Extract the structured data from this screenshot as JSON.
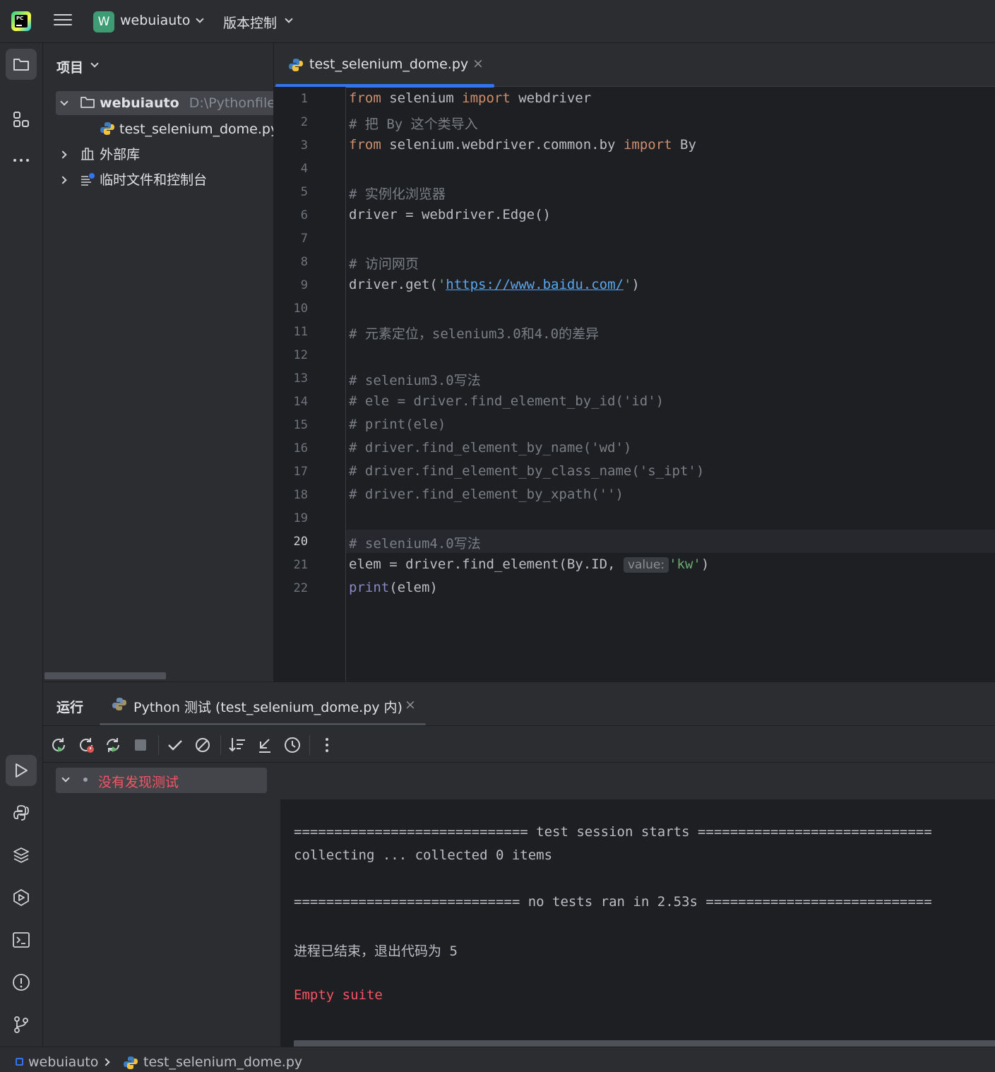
{
  "titlebar": {
    "project_initial": "W",
    "project_name": "webuiauto",
    "vcs_label": "版本控制"
  },
  "project_panel": {
    "title": "项目",
    "tree": [
      {
        "label": "webuiauto",
        "path": "D:\\Pythonfiles\\"
      },
      {
        "label": "test_selenium_dome.py"
      },
      {
        "label": "外部库"
      },
      {
        "label": "临时文件和控制台"
      }
    ]
  },
  "editor": {
    "tab_label": "test_selenium_dome.py",
    "tab_close": "×",
    "current_line": 20,
    "inlay_hint": "value:",
    "lines": {
      "l1": {
        "kw1": "from",
        "t1": " selenium ",
        "kw2": "import",
        "t2": " webdriver"
      },
      "l2": "# 把 By 这个类导入",
      "l3": {
        "kw1": "from",
        "t1": " selenium.webdriver.common.by ",
        "kw2": "import",
        "t2": " By"
      },
      "l5": "# 实例化浏览器",
      "l6": "driver = webdriver.Edge()",
      "l8": "# 访问网页",
      "l9": {
        "t1": "driver.get(",
        "q1": "'",
        "url": "https://www.baidu.com/",
        "q2": "'",
        "t2": ")"
      },
      "l11": "# 元素定位，selenium3.0和4.0的差异",
      "l13": "# selenium3.0写法",
      "l14": "# ele = driver.find_element_by_id('id')",
      "l15": "# print(ele)",
      "l16": "# driver.find_element_by_name('wd')",
      "l17": "# driver.find_element_by_class_name('s_ipt')",
      "l18": "# driver.find_element_by_xpath('')",
      "l20": "# selenium4.0写法",
      "l21": {
        "t1": "elem = driver.find_element(By.ID, ",
        "str": "'kw'",
        "t2": ")"
      },
      "l22": {
        "fn": "print",
        "t1": "(elem)"
      }
    }
  },
  "run_panel": {
    "title": "运行",
    "tab_label": "Python 测试 (test_selenium_dome.py 内)",
    "tab_close": "×",
    "test_tree_label": "没有发现测试",
    "console": [
      "============================= test session starts =============================",
      "collecting ... collected 0 items",
      "",
      "============================ no tests ran in 2.53s ============================",
      "",
      "进程已结束，退出代码为 5",
      "",
      "Empty suite"
    ]
  },
  "statusbar": {
    "project": "webuiauto",
    "file": "test_selenium_dome.py"
  },
  "colors": {
    "accent": "#3574f0",
    "error": "#f75464",
    "keyword": "#cf8e6d",
    "comment": "#7a7e85",
    "string": "#6aab73"
  }
}
